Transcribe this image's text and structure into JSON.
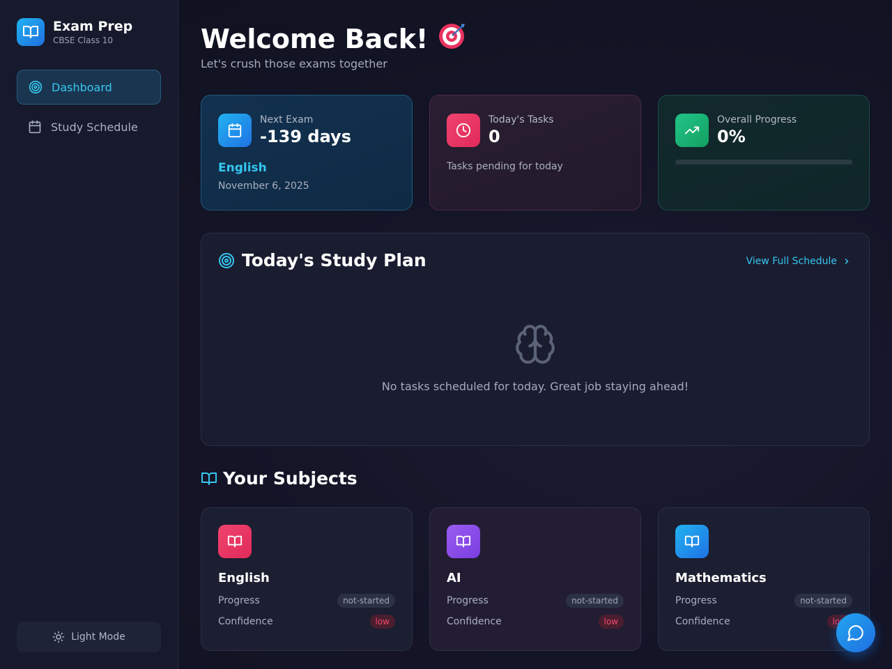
{
  "brand": {
    "title": "Exam Prep",
    "subtitle": "CBSE Class 10",
    "icon": "book-open-icon"
  },
  "sidebar": {
    "items": [
      {
        "label": "Dashboard",
        "icon": "target-icon",
        "active": true
      },
      {
        "label": "Study Schedule",
        "icon": "calendar-icon",
        "active": false
      }
    ],
    "theme_toggle": {
      "label": "Light Mode",
      "icon": "sun-icon"
    }
  },
  "header": {
    "title": "Welcome Back!",
    "emoji_icon": "dart-target-icon",
    "subtitle": "Let's crush those exams together"
  },
  "stats": {
    "next_exam": {
      "label": "Next Exam",
      "value": "-139 days",
      "subject": "English",
      "date": "November 6, 2025"
    },
    "todays_tasks": {
      "label": "Today's Tasks",
      "value": "0",
      "note": "Tasks pending for today"
    },
    "overall_progress": {
      "label": "Overall Progress",
      "value": "0%",
      "fraction": 0
    }
  },
  "study_plan": {
    "title": "Today's Study Plan",
    "link": "View Full Schedule",
    "empty_message": "No tasks scheduled for today. Great job staying ahead!"
  },
  "subjects": {
    "title": "Your Subjects",
    "progress_label": "Progress",
    "confidence_label": "Confidence",
    "items": [
      {
        "name": "English",
        "progress": "not-started",
        "confidence": "low",
        "color": "#e8335f"
      },
      {
        "name": "AI",
        "progress": "not-started",
        "confidence": "low",
        "color": "#8a4ce8"
      },
      {
        "name": "Mathematics",
        "progress": "not-started",
        "confidence": "low",
        "color": "#1f8ee8"
      }
    ]
  },
  "colors": {
    "accent": "#35c6f0",
    "success": "#22c48a",
    "danger": "#f0496e"
  }
}
